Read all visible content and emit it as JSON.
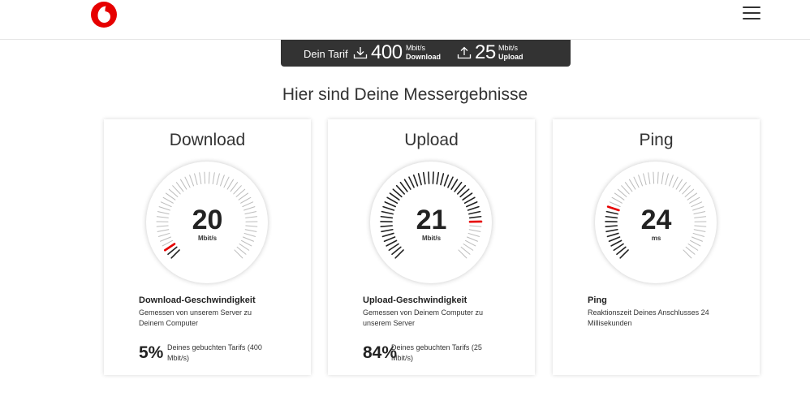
{
  "header": {
    "logo_icon": "vodafone-logo",
    "menu_icon": "hamburger-menu-icon"
  },
  "tariff": {
    "label": "Dein Tarif",
    "download_icon": "download-icon",
    "download_value": "400",
    "download_unit": "Mbit/s",
    "download_label": "Download",
    "upload_icon": "upload-icon",
    "upload_value": "25",
    "upload_unit": "Mbit/s",
    "upload_label": "Upload"
  },
  "results": {
    "heading": "Hier sind Deine Messergebnisse"
  },
  "cards": [
    {
      "title": "Download",
      "value": "20",
      "unit": "Mbit/s",
      "gauge_fraction": 0.05,
      "metric_title": "Download-Geschwindigkeit",
      "metric_desc": "Gemessen von unserem Server zu Deinem Computer",
      "percent": "5%",
      "percent_desc": "Deines gebuchten Tarifs (400 Mbit/s)"
    },
    {
      "title": "Upload",
      "value": "21",
      "unit": "Mbit/s",
      "gauge_fraction": 0.84,
      "metric_title": "Upload-Geschwindigkeit",
      "metric_desc": "Gemessen von Deinem Computer zu unserem Server",
      "percent": "84%",
      "percent_desc": "Deines gebuchten Tarifs (25 Mbit/s)"
    },
    {
      "title": "Ping",
      "value": "24",
      "unit": "ms",
      "gauge_fraction": 0.24,
      "metric_title": "Ping",
      "metric_desc": "Reaktionszeit Deines Anschlusses 24 Millisekunden"
    }
  ],
  "colors": {
    "accent": "#e60000",
    "tariff_bg": "#333333",
    "tick_active": "#222222",
    "tick_inactive": "#bbbbbb"
  }
}
